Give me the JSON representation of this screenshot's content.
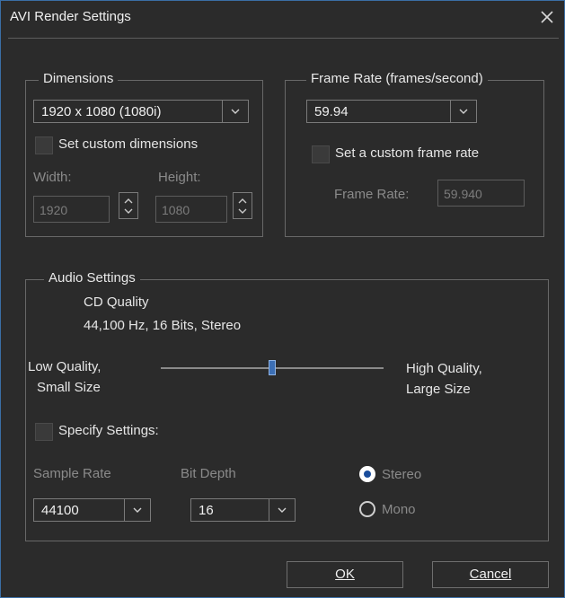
{
  "window": {
    "title": "AVI Render Settings"
  },
  "dimensions": {
    "legend": "Dimensions",
    "selected": "1920 x 1080 (1080i)",
    "custom_checkbox_label": "Set custom dimensions",
    "custom_checked": false,
    "width_label": "Width:",
    "height_label": "Height:",
    "width_value": "1920",
    "height_value": "1080"
  },
  "frame_rate": {
    "legend": "Frame Rate (frames/second)",
    "selected": "59.94",
    "custom_checkbox_label": "Set a custom frame rate",
    "custom_checked": false,
    "field_label": "Frame Rate:",
    "field_value": "59.940"
  },
  "audio": {
    "legend": "Audio Settings",
    "quality_name": "CD Quality",
    "quality_detail": "44,100 Hz, 16 Bits, Stereo",
    "low_label_1": "Low Quality,",
    "low_label_2": "Small Size",
    "high_label_1": "High Quality,",
    "high_label_2": "Large Size",
    "slider_level": 0.5,
    "specify_label": "Specify Settings:",
    "specify_checked": false,
    "sample_rate_label": "Sample Rate",
    "sample_rate_value": "44100",
    "bit_depth_label": "Bit Depth",
    "bit_depth_value": "16",
    "channels": [
      {
        "label": "Stereo",
        "selected": true
      },
      {
        "label": "Mono",
        "selected": false
      }
    ]
  },
  "buttons": {
    "ok": "OK",
    "cancel": "Cancel"
  },
  "colors": {
    "background": "#2b2b2b",
    "border": "#3a6ea5",
    "slider_thumb": "#3c6fb5",
    "text": "#e6e6e6",
    "disabled_text": "#8a8a8a"
  },
  "icons": {
    "close": "close-icon",
    "dropdown": "chevron-down-icon",
    "spin_up": "chevron-up-icon"
  }
}
